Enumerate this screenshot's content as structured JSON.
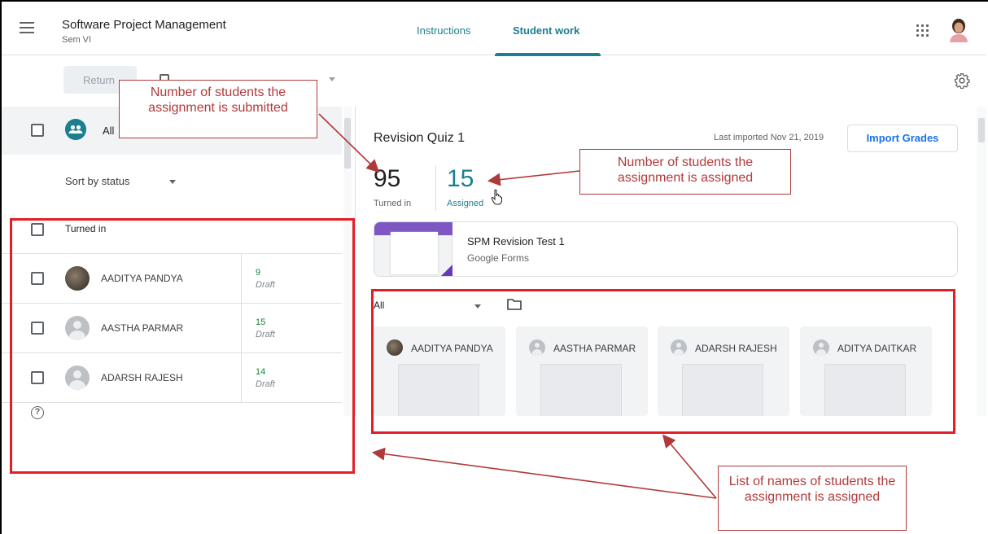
{
  "header": {
    "course_title": "Software Project Management",
    "course_sub": "Sem VI",
    "tabs": [
      {
        "label": "Instructions"
      },
      {
        "label": "Student work"
      }
    ],
    "icons": {
      "menu": "hamburger-menu-icon",
      "apps": "google-apps-grid-icon",
      "profile": "user-avatar"
    }
  },
  "toolbar": {
    "return_label": "Return",
    "icons": {
      "settings": "gear-icon"
    }
  },
  "left": {
    "all_label": "All",
    "sort_label": "Sort by status",
    "section_label": "Turned in",
    "students": [
      {
        "name": "AADITYA PANDYA",
        "grade": "9",
        "status": "Draft"
      },
      {
        "name": "AASTHA PARMAR",
        "grade": "15",
        "status": "Draft"
      },
      {
        "name": "ADARSH RAJESH",
        "grade": "14",
        "status": "Draft"
      }
    ]
  },
  "right": {
    "quiz_title": "Revision Quiz 1",
    "last_imported": "Last imported Nov 21, 2019",
    "import_label": "Import Grades",
    "turned_in_count": "95",
    "turned_in_label": "Turned in",
    "assigned_count": "15",
    "assigned_label": "Assigned",
    "attachment": {
      "title": "SPM Revision Test 1",
      "type": "Google Forms"
    },
    "filter_label": "All",
    "cards": [
      {
        "name": "AADITYA PANDYA"
      },
      {
        "name": "AASTHA PARMAR"
      },
      {
        "name": "ADARSH RAJESH"
      },
      {
        "name": "ADITYA DAITKAR"
      }
    ]
  },
  "annotations": {
    "submitted": "Number of students the assignment is submitted",
    "assigned": "Number of students the assignment is assigned",
    "list": "List of names of students the assignment is assigned"
  },
  "colors": {
    "accent": "#1a7f8e",
    "annotation_red": "#e41e26",
    "callout_text": "#b03a3a",
    "grade_green": "#188038"
  }
}
